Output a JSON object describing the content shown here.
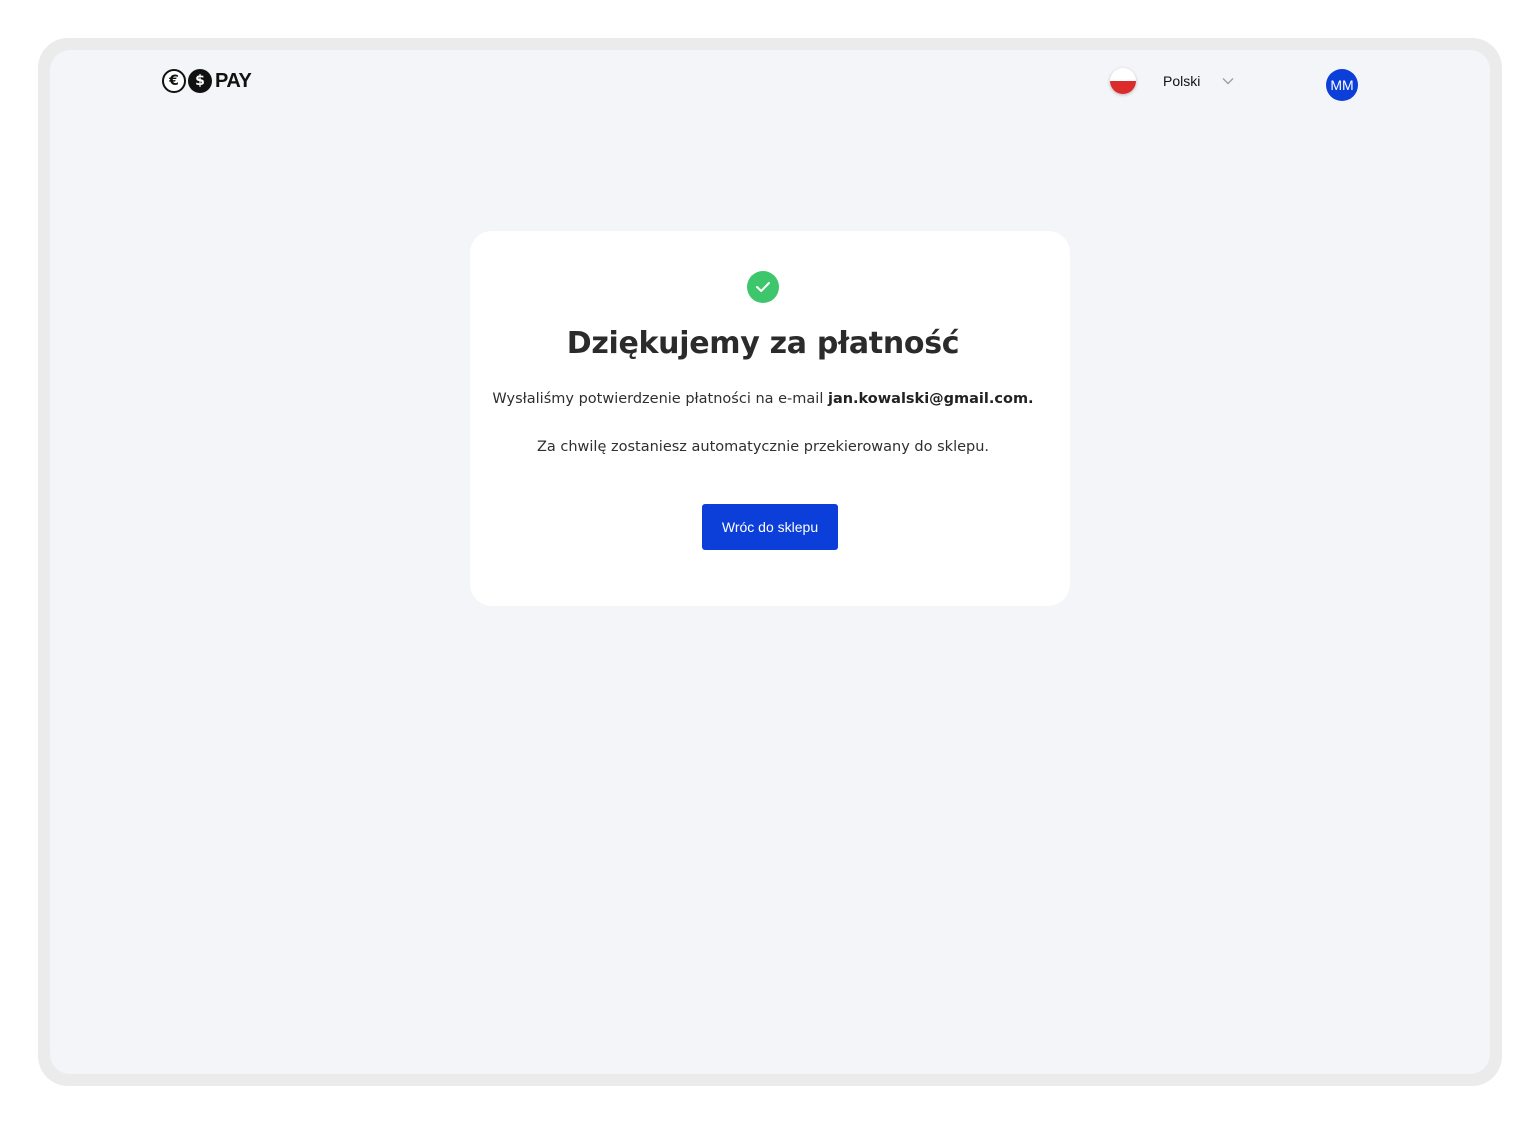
{
  "header": {
    "logo": {
      "euro_symbol": "€",
      "dollar_symbol": "$",
      "text": "PAY"
    },
    "language": {
      "label": "Polski",
      "flag_icon": "poland-flag-icon",
      "dropdown_icon": "chevron-down-icon"
    },
    "user": {
      "initials": "MM",
      "color": "#0c3fd9"
    }
  },
  "card": {
    "status_icon": "check-circle-icon",
    "status_color": "#3ec66c",
    "title": "Dziękujemy za płatność",
    "message_prefix": "Wysłaliśmy potwierdzenie płatności na e-mail",
    "email": "jan.kowalski@gmail.com.",
    "redirect_message": "Za chwilę zostaniesz automatycznie przekierowany do sklepu.",
    "button_label": "Wróc do sklepu",
    "button_color": "#0c3fd9"
  }
}
